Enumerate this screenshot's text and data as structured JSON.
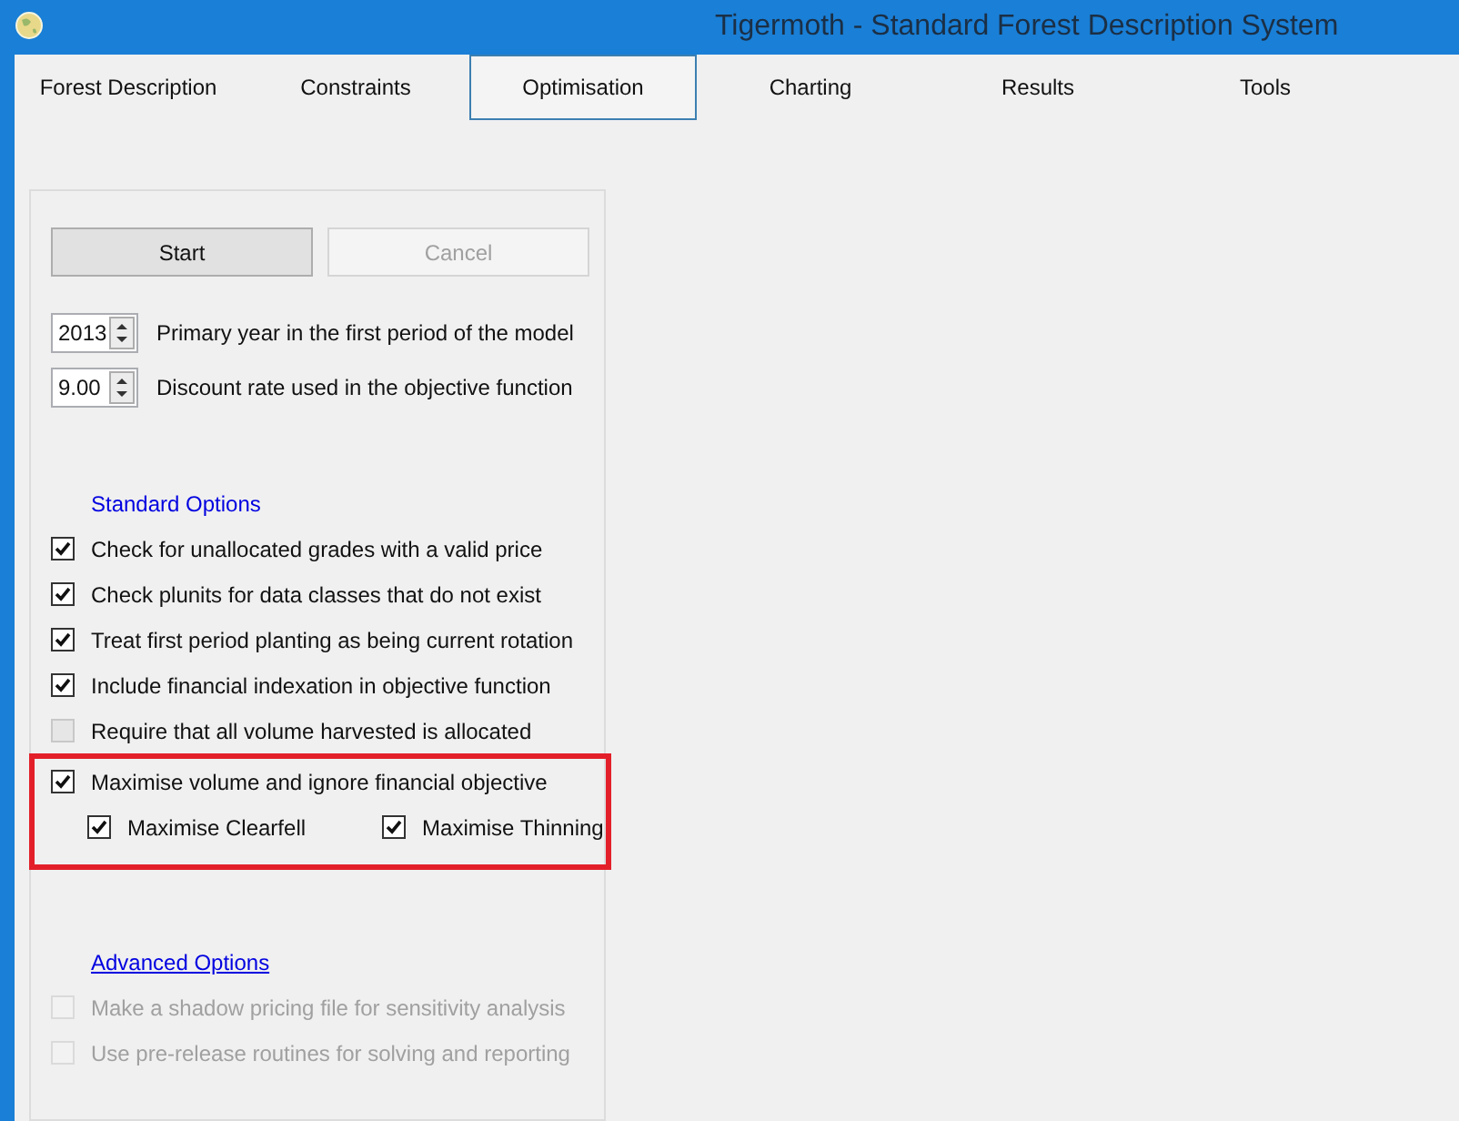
{
  "window": {
    "title": "Tigermoth - Standard Forest Description System"
  },
  "tabs": [
    {
      "label": "Forest Description",
      "selected": false
    },
    {
      "label": "Constraints",
      "selected": false
    },
    {
      "label": "Optimisation",
      "selected": true
    },
    {
      "label": "Charting",
      "selected": false
    },
    {
      "label": "Results",
      "selected": false
    },
    {
      "label": "Tools",
      "selected": false
    }
  ],
  "buttons": [
    {
      "label": "Start",
      "disabled": false
    },
    {
      "label": "Cancel",
      "disabled": true
    }
  ],
  "spinners": [
    {
      "value": "2013",
      "label": "Primary year in the first period of the model"
    },
    {
      "value": "9.00",
      "label": "Discount rate used in the objective function"
    }
  ],
  "standard_options": {
    "title": "Standard Options",
    "underlined": false,
    "items": [
      {
        "label": "Check for unallocated grades with a valid price",
        "checked": true,
        "disabled": false,
        "highlighted": false
      },
      {
        "label": "Check plunits for data classes that do not exist",
        "checked": true,
        "disabled": false,
        "highlighted": false
      },
      {
        "label": "Treat first period planting as being current rotation",
        "checked": true,
        "disabled": false,
        "highlighted": false
      },
      {
        "label": "Include financial indexation in objective function",
        "checked": true,
        "disabled": false,
        "highlighted": false
      },
      {
        "label": "Require that all volume harvested is allocated",
        "checked": false,
        "disabled": false,
        "highlighted": false
      },
      {
        "label": "Maximise volume and ignore financial objective",
        "checked": true,
        "disabled": false,
        "highlighted": true,
        "children": [
          {
            "label": "Maximise Clearfell",
            "checked": true,
            "disabled": false
          },
          {
            "label": "Maximise Thinning",
            "checked": true,
            "disabled": false
          }
        ]
      }
    ]
  },
  "advanced_options": {
    "title": "Advanced Options",
    "underlined": true,
    "items": [
      {
        "label": "Make a shadow pricing file for sensitivity analysis",
        "checked": false,
        "disabled": true,
        "highlighted": false
      },
      {
        "label": "Use pre-release routines for solving and reporting",
        "checked": false,
        "disabled": true,
        "highlighted": false
      }
    ]
  }
}
